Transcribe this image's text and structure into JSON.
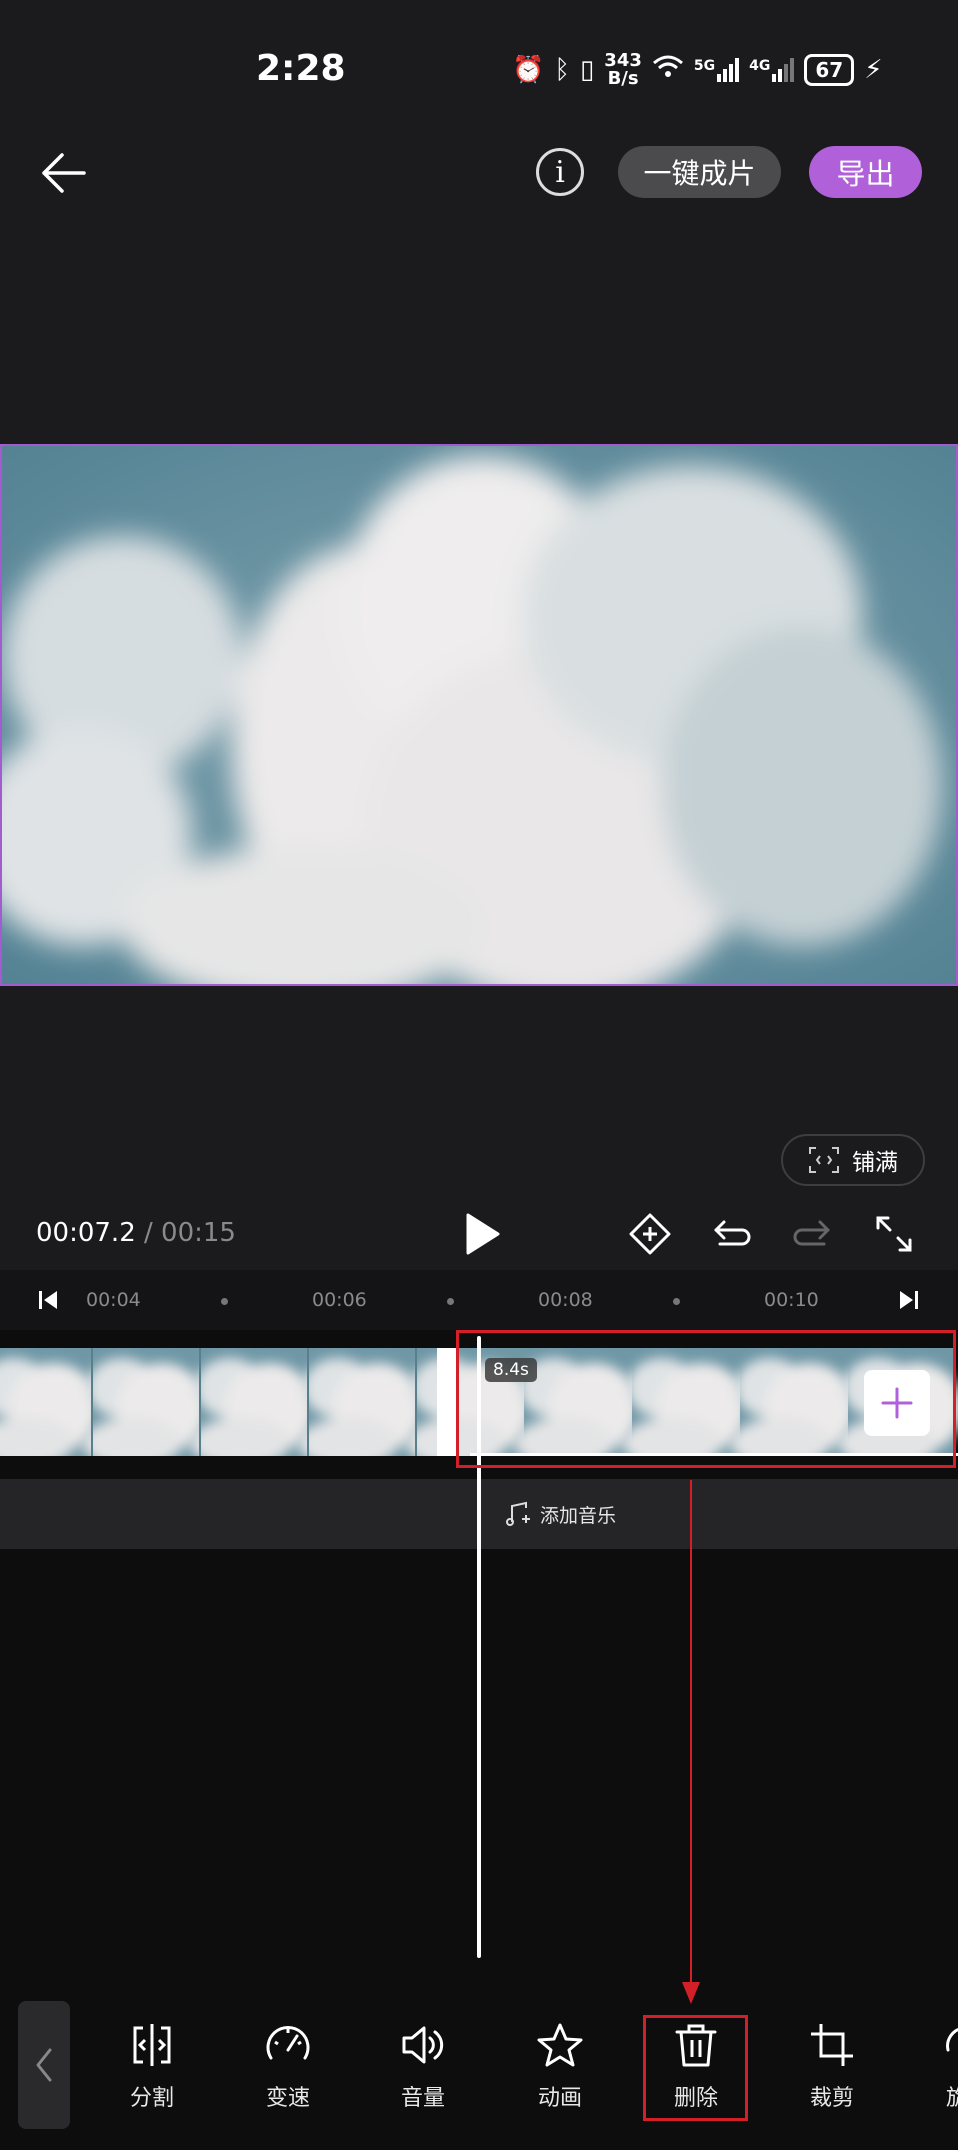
{
  "status_bar": {
    "time": "2:28",
    "net_speed_value": "343",
    "net_speed_unit": "B/s",
    "signal_1": "5G",
    "signal_2": "4G",
    "battery": "67"
  },
  "header": {
    "back_icon": "arrow-left-icon",
    "info_icon": "info-icon",
    "info_glyph": "i",
    "onekey_label": "一键成片",
    "export_label": "导出"
  },
  "preview": {
    "fill_label": "铺满",
    "fill_icon": "fit-frame-icon"
  },
  "transport": {
    "current_time": "00:07.2",
    "separator": " / ",
    "total_time": "00:15",
    "icons": [
      "play-icon",
      "keyframe-icon",
      "undo-icon",
      "redo-icon",
      "fullscreen-icon"
    ]
  },
  "ruler": {
    "ticks": [
      "00:04",
      "00:06",
      "00:08",
      "00:10"
    ]
  },
  "timeline": {
    "clip_duration": "8.4s",
    "add_music_label": "添加音乐",
    "playhead_time": "00:07.2"
  },
  "toolbar": {
    "tools": [
      {
        "label": "分割",
        "icon": "split-icon"
      },
      {
        "label": "变速",
        "icon": "speed-icon"
      },
      {
        "label": "音量",
        "icon": "volume-icon"
      },
      {
        "label": "动画",
        "icon": "animation-star-icon"
      },
      {
        "label": "删除",
        "icon": "trash-icon"
      },
      {
        "label": "裁剪",
        "icon": "crop-icon"
      },
      {
        "label": "旋",
        "icon": "rotate-icon"
      }
    ]
  },
  "colors": {
    "accent": "#b060d8",
    "background": "#1b1b1d",
    "annotation": "#d31f27"
  }
}
